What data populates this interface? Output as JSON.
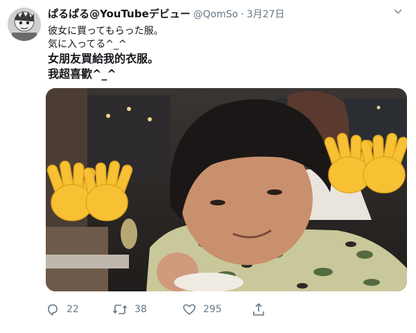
{
  "tweet": {
    "author": {
      "display_name": "ぱるぱる@YouTubeデビュー",
      "handle": "@QomSo",
      "separator": "·",
      "date": "3月27日"
    },
    "text_lines": [
      "彼女に買ってもらった服。",
      "気に入ってる^_^",
      "女朋友買給我的衣服。",
      "我超喜歡^_^"
    ],
    "media": {
      "emoji": "waving-hand",
      "emoji_color": "#f7c133"
    },
    "actions": {
      "reply_count": "22",
      "retweet_count": "38",
      "like_count": "295"
    },
    "icons": {
      "reply": "reply-icon",
      "retweet": "retweet-icon",
      "like": "like-icon",
      "share": "share-icon",
      "more": "caret-down-icon"
    },
    "colors": {
      "text": "#14171a",
      "secondary": "#657786"
    }
  }
}
